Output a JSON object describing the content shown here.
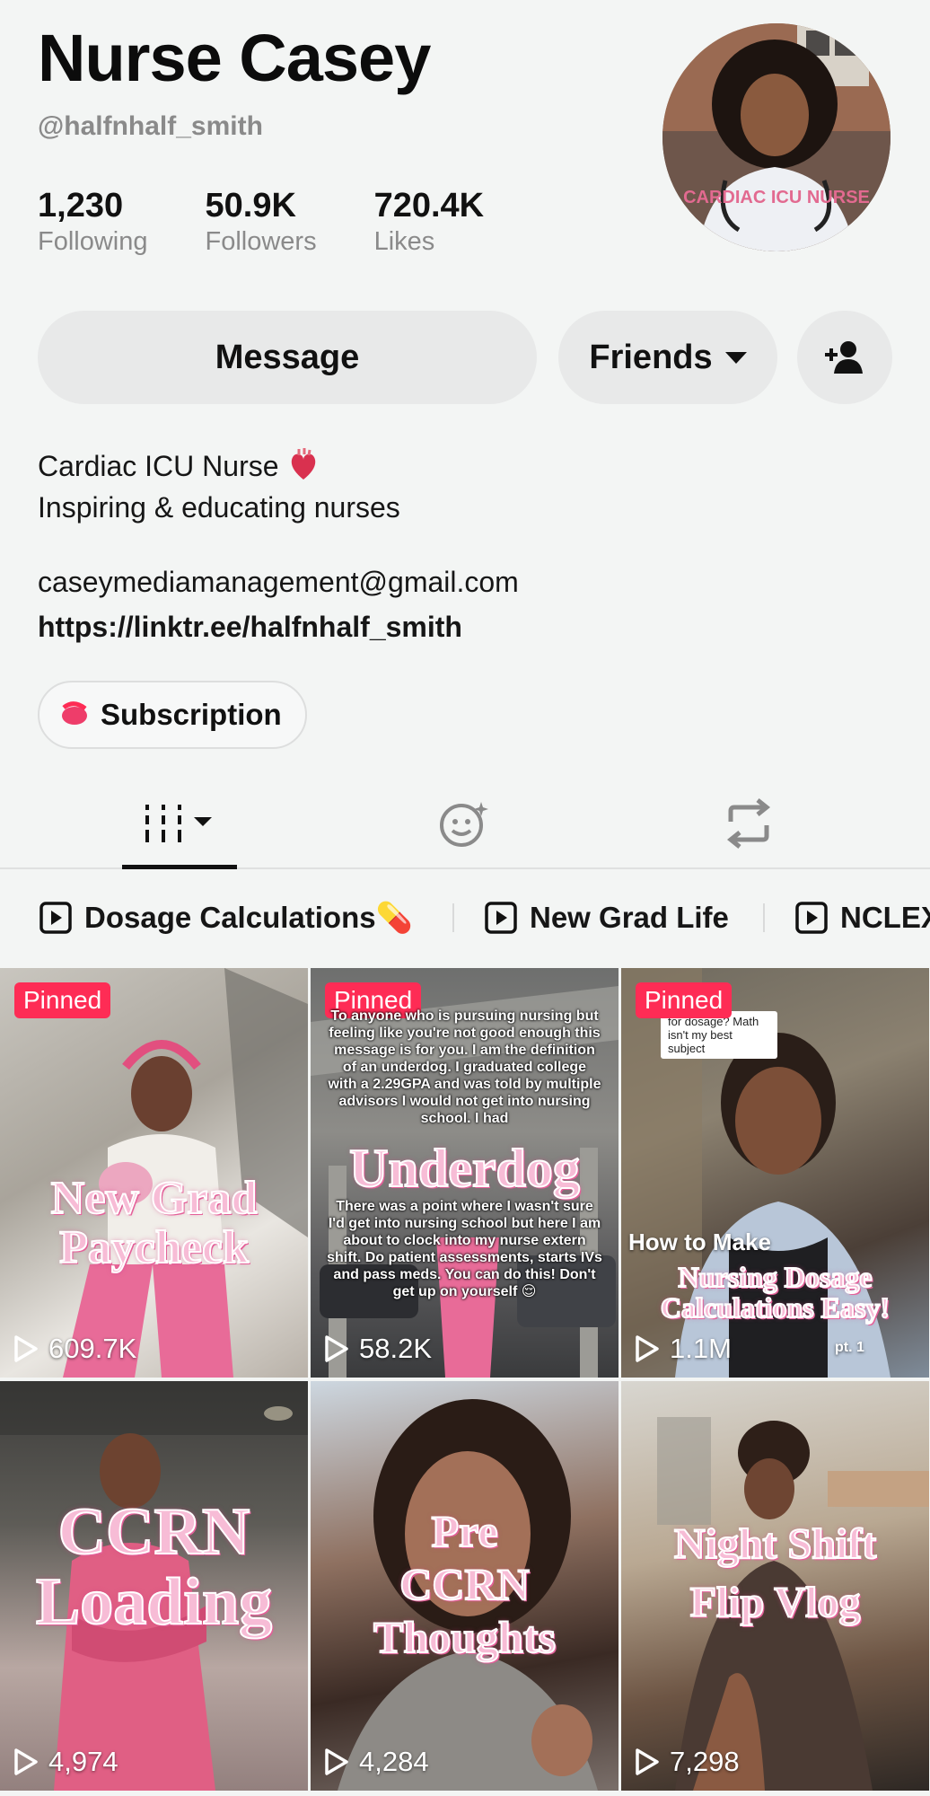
{
  "profile": {
    "name": "Nurse Casey",
    "handle": "@halfnhalf_smith",
    "avatar_text": "CARDIAC ICU NURSE",
    "stats": [
      {
        "value": "1,230",
        "label": "Following"
      },
      {
        "value": "50.9K",
        "label": "Followers"
      },
      {
        "value": "720.4K",
        "label": "Likes"
      }
    ]
  },
  "actions": {
    "message": "Message",
    "friends": "Friends",
    "add_friend_icon": "person-add-icon"
  },
  "bio": {
    "line1": "Cardiac ICU Nurse",
    "line2": "Inspiring & educating nurses",
    "email": "caseymediamanagement@gmail.com",
    "link": "https://linktr.ee/halfnhalf_smith",
    "subscription": "Subscription"
  },
  "tabs": [
    {
      "icon": "videos-grid-icon",
      "active": true
    },
    {
      "icon": "liked-face-icon",
      "active": false
    },
    {
      "icon": "repost-icon",
      "active": false
    }
  ],
  "playlists": [
    {
      "label": "Dosage Calculations💊"
    },
    {
      "label": "New Grad Life"
    },
    {
      "label": "NCLEX"
    }
  ],
  "videos": [
    {
      "pinned": "Pinned",
      "title_lines": [
        "New Grad",
        "Paycheck"
      ],
      "views": "609.7K"
    },
    {
      "pinned": "Pinned",
      "title_lines": [
        "Underdog"
      ],
      "views": "58.2K",
      "caption_top": "To anyone who is pursuing nursing but feeling like you're not good enough this message is for you. I am the definition of an underdog. I graduated college with a 2.29GPA and was told by multiple advisors I would not get into nursing school. I had",
      "caption_bottom": "There was a point where I wasn't sure I'd get into nursing school but here I am about to clock into my nurse extern shift. Do patient assessments, starts IVs and pass meds. You can do this! Don't get up on yourself 😌"
    },
    {
      "pinned": "Pinned",
      "title_lines": [
        "Nursing Dosage",
        "Calculations Easy!"
      ],
      "views": "1.1M",
      "pre_title": "How to Make",
      "note": "for dosage? Math isn't my best subject",
      "part": "pt. 1"
    },
    {
      "title_lines": [
        "CCRN",
        "Loading"
      ],
      "views": "4,974"
    },
    {
      "title_lines": [
        "Pre",
        "CCRN",
        "Thoughts"
      ],
      "views": "4,284"
    },
    {
      "title_lines": [
        "Night Shift",
        "Flip Vlog"
      ],
      "views": "7,298"
    }
  ],
  "colors": {
    "accent": "#fe2c55",
    "overlay_pink": "#f7bcd6"
  }
}
